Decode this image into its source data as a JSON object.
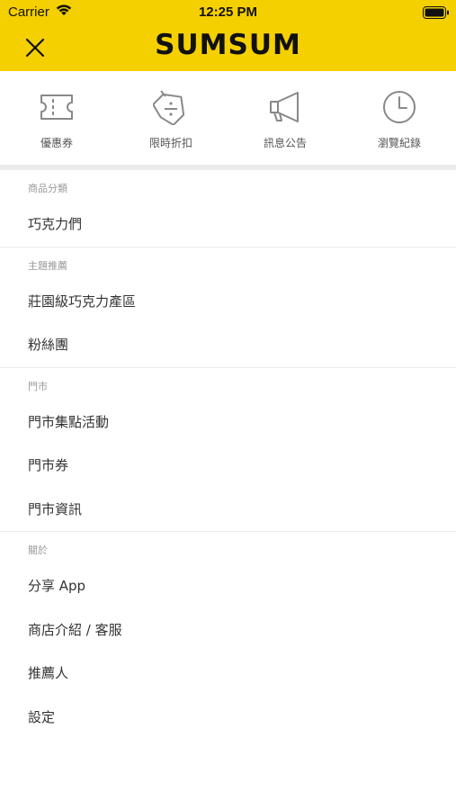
{
  "status_bar": {
    "carrier": "Carrier",
    "time": "12:25 PM"
  },
  "nav": {
    "logo": "SUMSUM"
  },
  "colors": {
    "brand_yellow": "#f5d000",
    "divider": "#ececec",
    "section_label": "#999999",
    "text": "#333333"
  },
  "quick_actions": [
    {
      "label": "優惠券",
      "icon": "ticket-icon"
    },
    {
      "label": "限時折扣",
      "icon": "discount-tag-icon"
    },
    {
      "label": "訊息公告",
      "icon": "megaphone-icon"
    },
    {
      "label": "瀏覽紀錄",
      "icon": "clock-icon"
    }
  ],
  "sections": [
    {
      "title": "商品分類",
      "items": [
        "巧克力們"
      ]
    },
    {
      "title": "主題推薦",
      "items": [
        "莊園級巧克力產區",
        "粉絲團"
      ]
    },
    {
      "title": "門市",
      "items": [
        "門市集點活動",
        "門市券",
        "門市資訊"
      ]
    },
    {
      "title": "關於",
      "items": [
        "分享 App",
        "商店介紹 / 客服",
        "推薦人",
        "設定"
      ]
    }
  ]
}
